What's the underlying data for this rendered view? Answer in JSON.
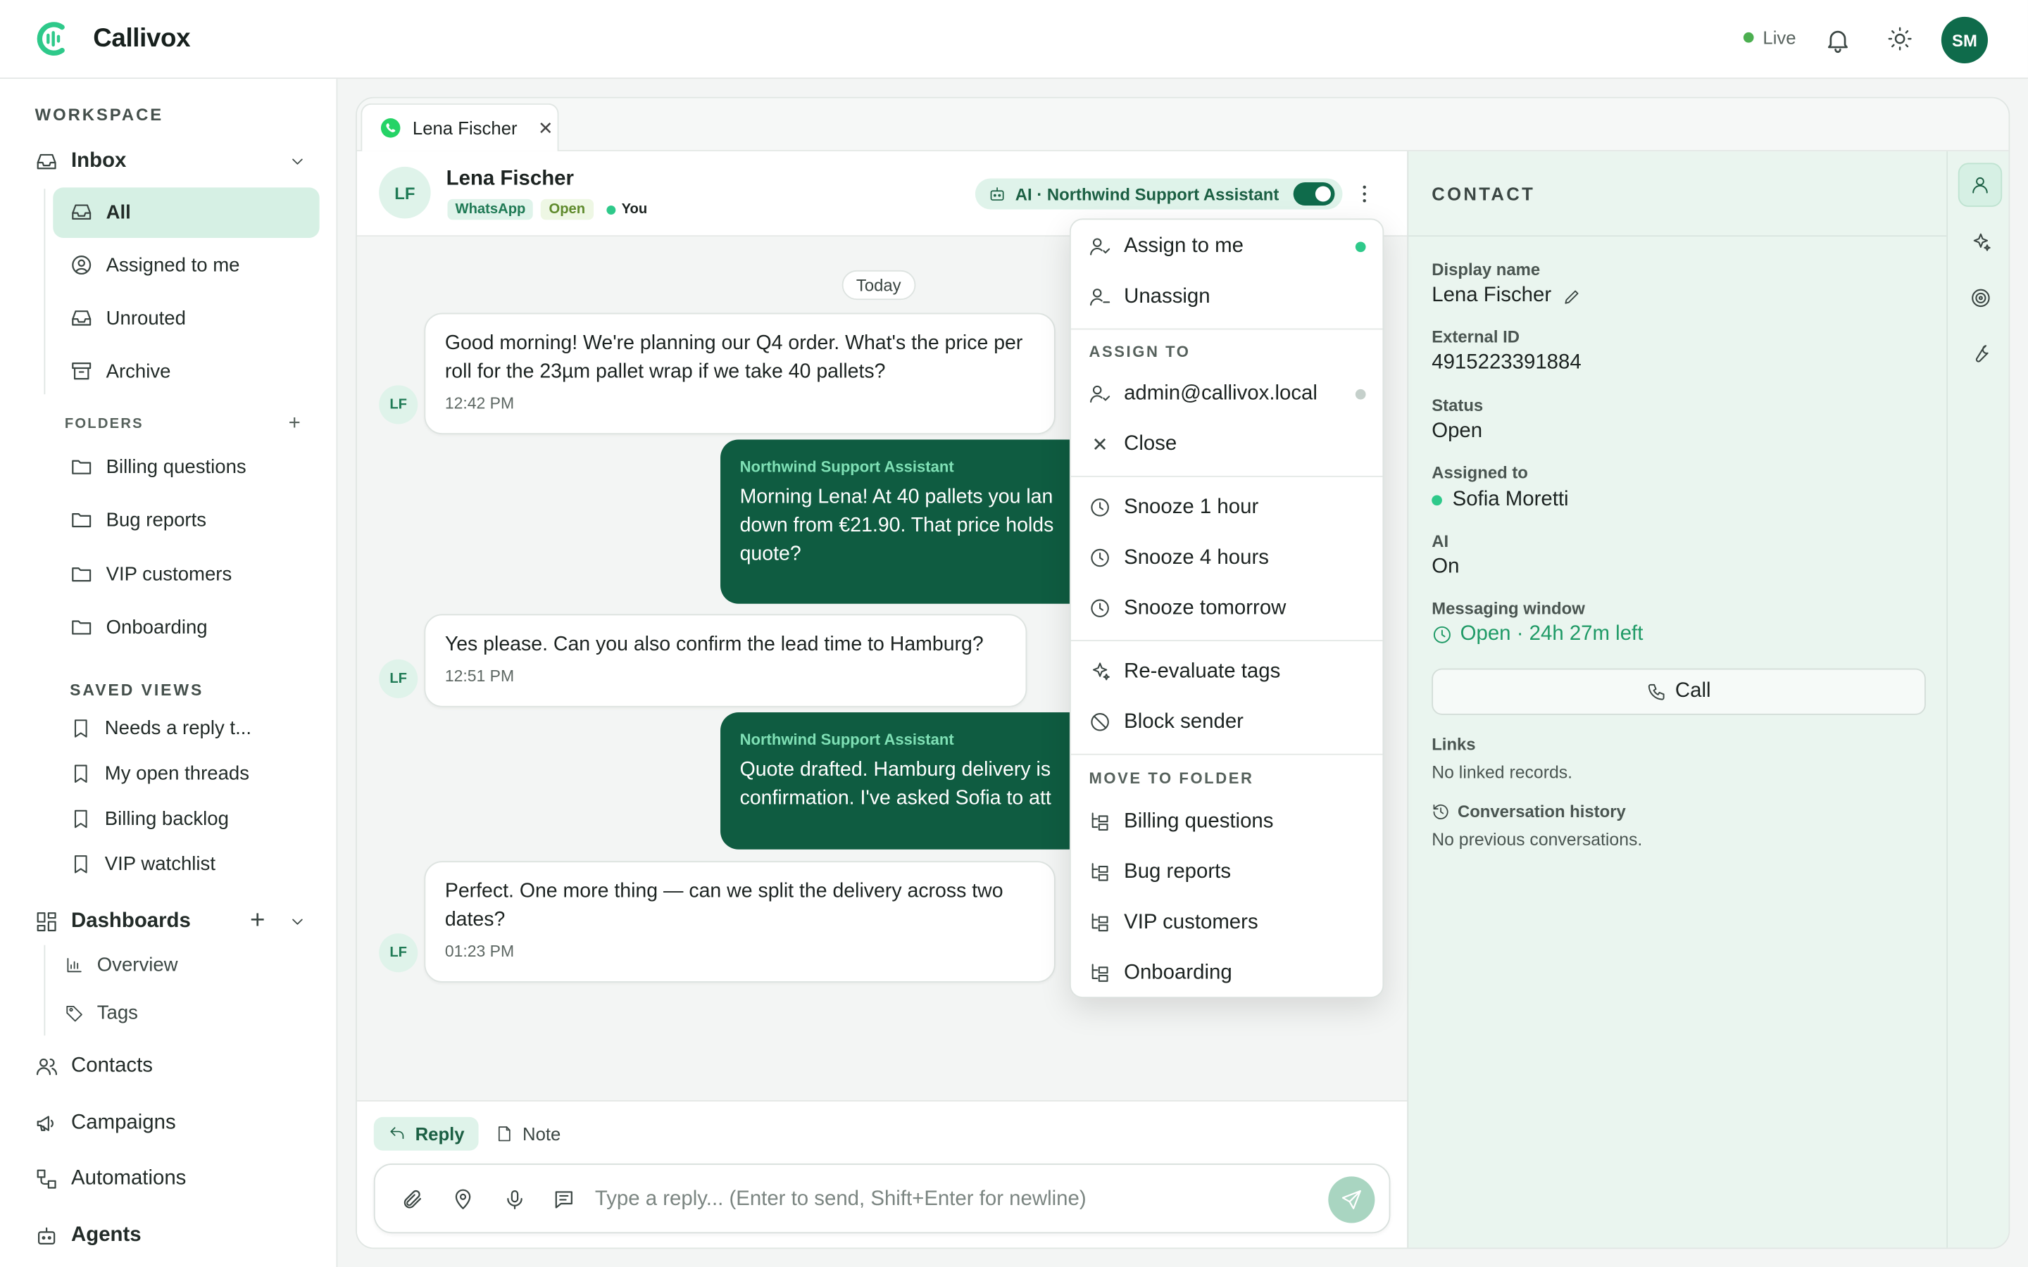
{
  "app": {
    "name": "Callivox"
  },
  "topbar": {
    "live_label": "Live",
    "user_initials": "SM",
    "accent": "#0f6b4b"
  },
  "sidebar": {
    "workspace_label": "WORKSPACE",
    "inbox": {
      "label": "Inbox",
      "items": [
        {
          "label": "All",
          "icon": "inbox-icon",
          "active": true
        },
        {
          "label": "Assigned to me",
          "icon": "user-circle-icon"
        },
        {
          "label": "Unrouted",
          "icon": "inbox-icon"
        },
        {
          "label": "Archive",
          "icon": "archive-icon"
        }
      ]
    },
    "folders_label": "FOLDERS",
    "folders": [
      "Billing questions",
      "Bug reports",
      "VIP customers",
      "Onboarding"
    ],
    "saved_views_label": "SAVED VIEWS",
    "saved_views": [
      "Needs a reply t...",
      "My open threads",
      "Billing backlog",
      "VIP watchlist"
    ],
    "dashboards": {
      "label": "Dashboards",
      "items": [
        "Overview",
        "Tags"
      ]
    },
    "bottom": [
      "Contacts",
      "Campaigns",
      "Automations",
      "Agents"
    ]
  },
  "tab": {
    "label": "Lena Fischer"
  },
  "conversation": {
    "initials": "LF",
    "name": "Lena Fischer",
    "channel": "WhatsApp",
    "status": "Open",
    "assignee_chip": "You",
    "ai_label": "AI · Northwind Support Assistant",
    "ai_enabled": true,
    "day_label": "Today",
    "messages": [
      {
        "dir": "in",
        "text": "Good morning! We're planning our Q4 order. What's the price per roll for the 23µm pallet wrap if we take 40 pallets?",
        "time": "12:42 PM"
      },
      {
        "dir": "out",
        "sender": "Northwind Support Assistant",
        "text": "Morning Lena! At 40 pallets you lan down from €21.90. That price holds quote?"
      },
      {
        "dir": "in",
        "text": "Yes please. Can you also confirm the lead time to Hamburg?",
        "time": "12:51 PM"
      },
      {
        "dir": "out",
        "sender": "Northwind Support Assistant",
        "text": "Quote drafted. Hamburg delivery is confirmation. I've asked Sofia to att"
      },
      {
        "dir": "in",
        "text": "Perfect. One more thing — can we split the delivery across two dates?",
        "time": "01:23 PM"
      }
    ]
  },
  "composer": {
    "reply_label": "Reply",
    "note_label": "Note",
    "placeholder": "Type a reply... (Enter to send, Shift+Enter for newline)"
  },
  "menu": {
    "assign_to_me": "Assign to me",
    "unassign": "Unassign",
    "assign_to_label": "ASSIGN TO",
    "agent": "admin@callivox.local",
    "close": "Close",
    "snooze_1h": "Snooze 1 hour",
    "snooze_4h": "Snooze 4 hours",
    "snooze_tomorrow": "Snooze tomorrow",
    "reevaluate": "Re-evaluate tags",
    "block": "Block sender",
    "move_label": "MOVE TO FOLDER",
    "folders": [
      "Billing questions",
      "Bug reports",
      "VIP customers",
      "Onboarding"
    ]
  },
  "contact": {
    "heading": "CONTACT",
    "display_name_label": "Display name",
    "display_name": "Lena Fischer",
    "external_id_label": "External ID",
    "external_id": "4915223391884",
    "status_label": "Status",
    "status": "Open",
    "assigned_label": "Assigned to",
    "assigned": "Sofia Moretti",
    "ai_label": "AI",
    "ai": "On",
    "window_label": "Messaging window",
    "window": "Open · 24h 27m left",
    "call_label": "Call",
    "links_label": "Links",
    "links": "No linked records.",
    "history_label": "Conversation history",
    "history": "No previous conversations."
  }
}
